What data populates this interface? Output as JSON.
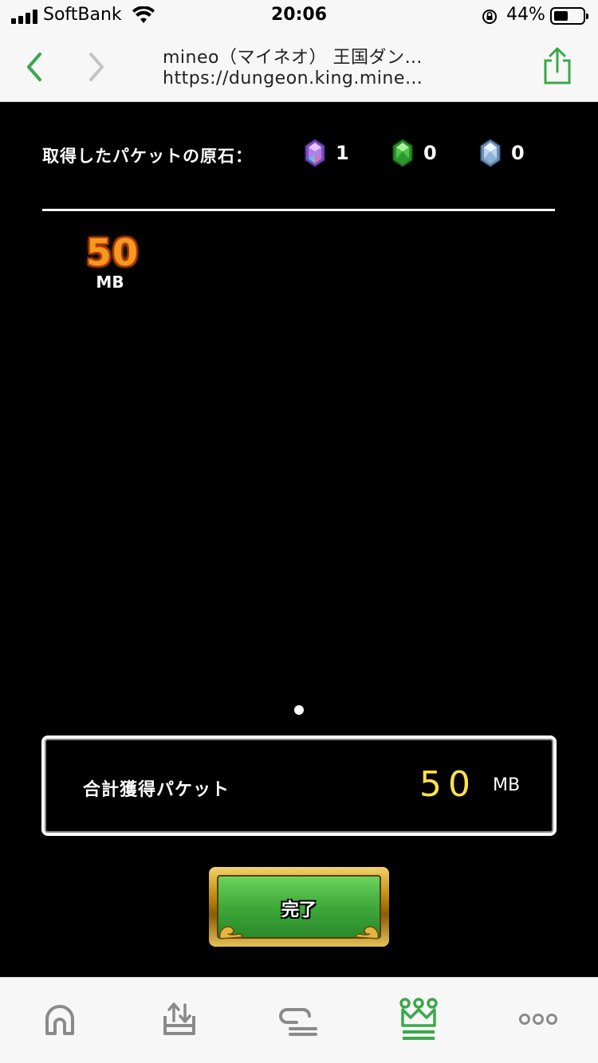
{
  "status_bar": {
    "carrier": "SoftBank",
    "time": "20:06",
    "battery_percent": "44%",
    "icons": [
      "signal-icon",
      "wifi-icon",
      "rotation-lock-icon",
      "battery-icon"
    ]
  },
  "browser": {
    "page_title": "mineo（マイネオ） 王国ダン…",
    "page_url": "https://dungeon.king.mine…",
    "icons": [
      "back-icon",
      "forward-icon",
      "share-icon"
    ],
    "accent_color": "#3aa84a"
  },
  "game": {
    "stones_label": "取得したパケットの原石：",
    "stones": [
      {
        "icon": "purple-gem-icon",
        "count": "1",
        "color": "#9b6fd1"
      },
      {
        "icon": "green-gem-icon",
        "count": "0",
        "color": "#3fb53a"
      },
      {
        "icon": "blue-gem-icon",
        "count": "0",
        "color": "#9fc3e6"
      }
    ],
    "reward": {
      "amount": "50",
      "unit": "MB"
    },
    "total": {
      "label": "合計獲得パケット",
      "value": "50",
      "unit": "MB"
    },
    "complete_button_label": "完了"
  },
  "tab_bar": {
    "tabs": [
      "home-icon",
      "tray-upload-icon",
      "chat-icon",
      "crown-icon",
      "more-icon"
    ],
    "active_tab": "crown-icon"
  }
}
